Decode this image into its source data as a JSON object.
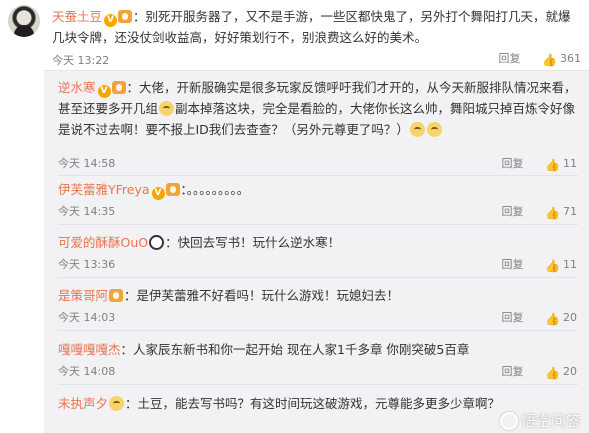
{
  "main_comment": {
    "user": "天蚕土豆",
    "text": "：别死开服务器了，又不是手游，一些区都快鬼了，另外打个舞阳打几天，就爆几块令牌，还没仗剑收益高，好好策划行不，别浪费这么好的美术。",
    "time": "今天 13:22",
    "reply_label": "回复",
    "like_count": "361",
    "badge": "V"
  },
  "replies": [
    {
      "user": "逆水寒",
      "text_a": "：大佬，开新服确实是很多玩家反馈呼吁我们才开的，从今天新服排队情况来看，甚至还要多开几组",
      "text_b": "副本掉落这块，完全是看脸的，大佬你长这么帅，舞阳城只掉百炼令好像是说不过去啊！要不报上ID我们去查查？（另外元尊更了吗？）",
      "time": "今天 14:58",
      "reply_label": "回复",
      "like_count": "11"
    },
    {
      "user": "伊芙蕾雅YFreya",
      "text": "：。。。。。。。。。",
      "time": "今天 14:35",
      "reply_label": "回复",
      "like_count": "71"
    },
    {
      "user": "可爱的酥酥OuO",
      "text": "：快回去写书！玩什么逆水寒！",
      "time": "今天 13:36",
      "reply_label": "回复",
      "like_count": "11"
    },
    {
      "user": "是策哥阿",
      "text": "：是伊芙蕾雅不好看吗！玩什么游戏！玩媳妇去！",
      "time": "今天 14:03",
      "reply_label": "回复",
      "like_count": "20"
    },
    {
      "user": "嘎嘎嘎嘎杰",
      "text": "：人家辰东新书和你一起开始 现在人家1千多章 你刚突破5百章",
      "time": "今天 14:08",
      "reply_label": "回复",
      "like_count": "20"
    },
    {
      "user": "未执声夕",
      "text": "：土豆，能去写书吗？有这时间玩这破游戏，元尊能多更多少章啊？",
      "time": "",
      "reply_label": "",
      "like_count": ""
    }
  ],
  "watermark": "悟空问答",
  "colors": {
    "username": "#eb7350",
    "reply_bg": "#f2f2f5",
    "meta": "#808080"
  }
}
